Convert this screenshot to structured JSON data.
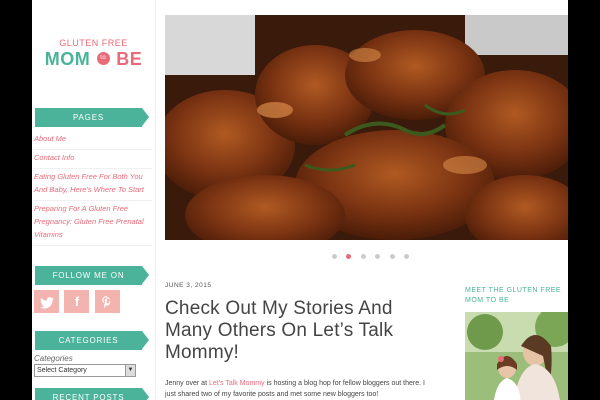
{
  "logo": {
    "top": "GLUTEN FREE",
    "main": "MOM",
    "to": "to",
    "be": "BE"
  },
  "widgets": {
    "pages_title": "PAGES",
    "follow_title": "FOLLOW ME ON",
    "categories_title": "CATEGORIES",
    "recent_title": "RECENT POSTS"
  },
  "pages": [
    "About Me",
    "Contact Info",
    "Eating Gluten Free For Both You And Baby, Here's Where To Start",
    "Preparing For A Gluten Free Pregnancy: Gluten Free Prenatal Vitamins"
  ],
  "social_icons": [
    "twitter-icon",
    "facebook-icon",
    "pinterest-icon"
  ],
  "categories": {
    "label": "Categories",
    "selected": "Select Category"
  },
  "slider": {
    "dots": 6,
    "active_index": 1
  },
  "post": {
    "date": "JUNE 3, 2015",
    "title": "Check Out My Stories And Many Others On Let’s Talk Mommy!",
    "excerpt_before": "Jenny over at ",
    "excerpt_link": "Let's Talk Mommy",
    "excerpt_after": " is hosting a blog hop for fellow bloggers out there. I just shared two of my favorite posts and met some new bloggers too!"
  },
  "about": {
    "title": "MEET THE GLUTEN FREE MOM TO BE"
  },
  "colors": {
    "teal": "#4ab39a",
    "pink": "#e96b7a",
    "social": "#f3b3ae"
  }
}
